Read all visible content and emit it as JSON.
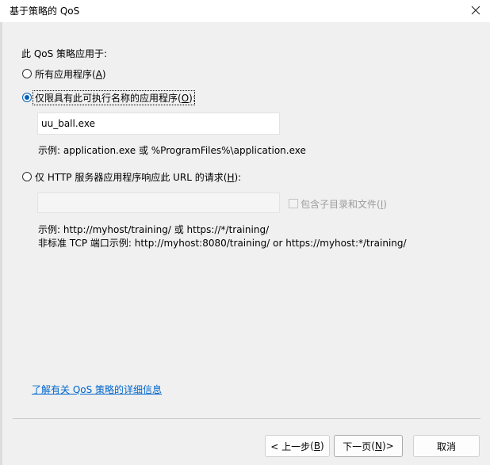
{
  "window": {
    "title": "基于策略的 QoS",
    "close_icon": "close-icon"
  },
  "section_label": "此 QoS 策略应用于:",
  "options": {
    "all_apps": {
      "label": "所有应用程序",
      "mnemonic": "A",
      "checked": false
    },
    "named_app": {
      "label": "仅限具有此可执行名称的应用程序",
      "mnemonic": "O",
      "checked": true
    },
    "http": {
      "label": "仅 HTTP 服务器应用程序响应此 URL 的请求",
      "mnemonic": "H",
      "checked": false
    }
  },
  "exe_input": {
    "value": "uu_ball.exe"
  },
  "exe_example": "示例:  application.exe 或 %ProgramFiles%\\application.exe",
  "url_input": {
    "value": ""
  },
  "include_subdirs": {
    "label": "包含子目录和文件",
    "mnemonic": "I",
    "checked": false
  },
  "url_example_1": "示例:  http://myhost/training/ 或 https://*/training/",
  "url_example_2": "非标准 TCP 端口示例:  http://myhost:8080/training/ or https://myhost:*/training/",
  "help_link": "了解有关 QoS 策略的详细信息",
  "buttons": {
    "back": {
      "label": "< 上一步",
      "mnemonic": "B"
    },
    "next": {
      "label": "下一页",
      "mnemonic": "N",
      "suffix": " >"
    },
    "cancel": {
      "label": "取消"
    }
  }
}
